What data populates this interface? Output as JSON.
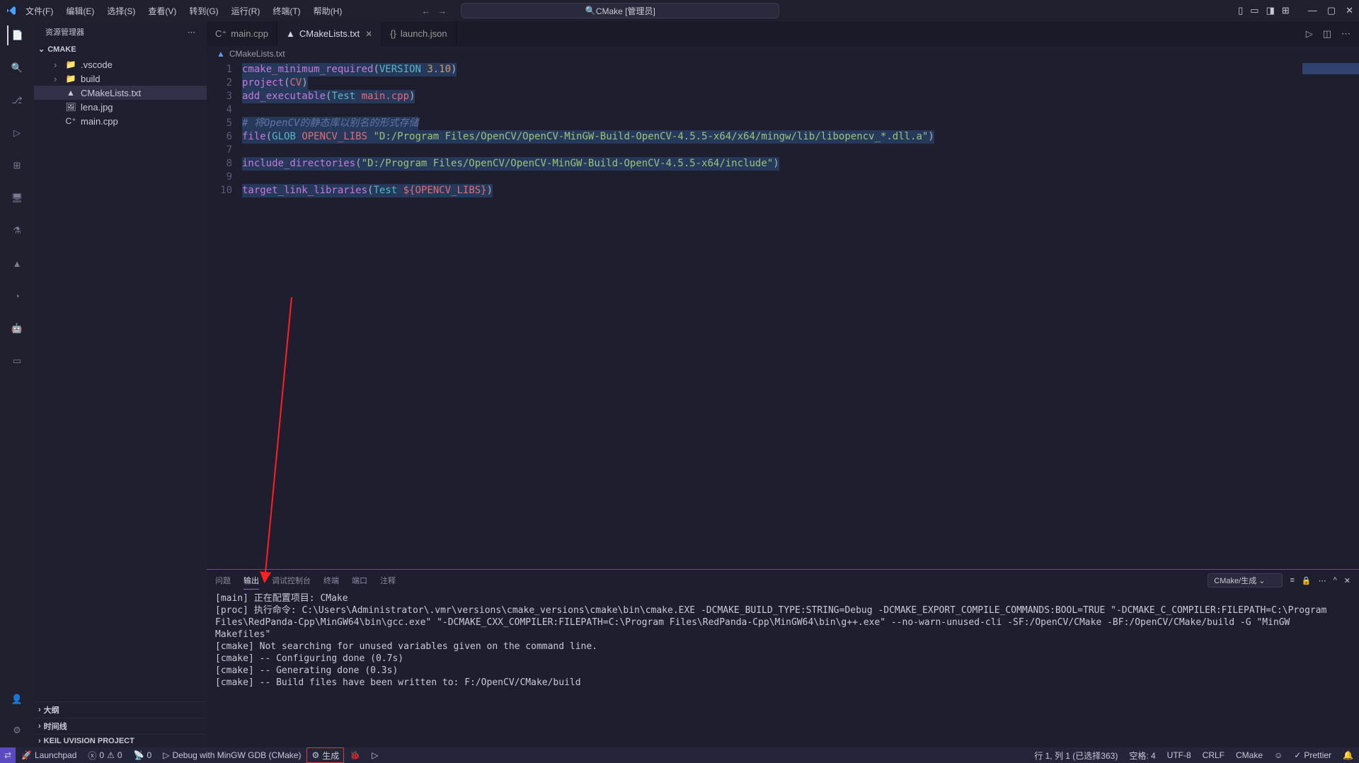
{
  "titlebar": {
    "menus": [
      "文件(F)",
      "编辑(E)",
      "选择(S)",
      "查看(V)",
      "转到(G)",
      "运行(R)",
      "终端(T)",
      "帮助(H)"
    ],
    "search_label": "CMake [管理员]"
  },
  "activitybar": {
    "items": [
      "explorer-icon",
      "search-icon",
      "scm-icon",
      "debug-icon",
      "extensions-icon",
      "remote-icon",
      "testing-icon",
      "cmake-icon",
      "timer-icon",
      "robot-icon",
      "layout-icon"
    ],
    "bottom_items": [
      "account-icon",
      "settings-icon"
    ]
  },
  "sidebar": {
    "title": "资源管理器",
    "project": "CMAKE",
    "tree": [
      {
        "label": ".vscode",
        "icon": "folder",
        "expandable": true
      },
      {
        "label": "build",
        "icon": "folder",
        "expandable": true
      },
      {
        "label": "CMakeLists.txt",
        "icon": "cmake",
        "selected": true
      },
      {
        "label": "lena.jpg",
        "icon": "image"
      },
      {
        "label": "main.cpp",
        "icon": "cpp"
      }
    ],
    "bottom_sections": [
      "大纲",
      "时间线",
      "KEIL UVISION PROJECT"
    ]
  },
  "tabs": [
    {
      "label": "main.cpp",
      "icon": "cpp",
      "active": false
    },
    {
      "label": "CMakeLists.txt",
      "icon": "cmake",
      "active": true
    },
    {
      "label": "launch.json",
      "icon": "json",
      "active": false
    }
  ],
  "breadcrumb": {
    "file": "CMakeLists.txt"
  },
  "editor": {
    "lines": [
      {
        "n": 1,
        "tokens": [
          [
            "tok-fn",
            "cmake_minimum_required"
          ],
          [
            "tok-punct",
            "("
          ],
          [
            "tok-kw",
            "VERSION"
          ],
          [
            "tok-punct",
            " "
          ],
          [
            "tok-num",
            "3.10"
          ],
          [
            "tok-punct",
            ")"
          ]
        ],
        "sel": true
      },
      {
        "n": 2,
        "tokens": [
          [
            "tok-fn",
            "project"
          ],
          [
            "tok-punct",
            "("
          ],
          [
            "tok-var",
            "CV"
          ],
          [
            "tok-punct",
            ")"
          ]
        ],
        "sel": true
      },
      {
        "n": 3,
        "tokens": [
          [
            "tok-fn",
            "add_executable"
          ],
          [
            "tok-punct",
            "("
          ],
          [
            "tok-kw",
            "Test"
          ],
          [
            "tok-punct",
            " "
          ],
          [
            "tok-var",
            "main.cpp"
          ],
          [
            "tok-punct",
            ")"
          ]
        ],
        "sel": true
      },
      {
        "n": 4,
        "tokens": [],
        "sel": true
      },
      {
        "n": 5,
        "tokens": [
          [
            "tok-cmt",
            "# 将OpenCV的静态库以别名的形式存储"
          ]
        ],
        "sel": true
      },
      {
        "n": 6,
        "tokens": [
          [
            "tok-fn",
            "file"
          ],
          [
            "tok-punct",
            "("
          ],
          [
            "tok-kw",
            "GLOB"
          ],
          [
            "tok-punct",
            " "
          ],
          [
            "tok-var",
            "OPENCV_LIBS"
          ],
          [
            "tok-punct",
            " "
          ],
          [
            "tok-str",
            "\"D:/Program Files/OpenCV/OpenCV-MinGW-Build-OpenCV-4.5.5-x64/x64/mingw/lib/libopencv_*.dll.a\""
          ],
          [
            "tok-punct",
            ")"
          ]
        ],
        "sel": true
      },
      {
        "n": 7,
        "tokens": [],
        "sel": true
      },
      {
        "n": 8,
        "tokens": [
          [
            "tok-fn",
            "include_directories"
          ],
          [
            "tok-punct",
            "("
          ],
          [
            "tok-str",
            "\"D:/Program Files/OpenCV/OpenCV-MinGW-Build-OpenCV-4.5.5-x64/include\""
          ],
          [
            "tok-punct",
            ")"
          ]
        ],
        "sel": true
      },
      {
        "n": 9,
        "tokens": [],
        "sel": true
      },
      {
        "n": 10,
        "tokens": [
          [
            "tok-fn",
            "target_link_libraries"
          ],
          [
            "tok-punct",
            "("
          ],
          [
            "tok-kw",
            "Test"
          ],
          [
            "tok-punct",
            " "
          ],
          [
            "tok-var",
            "${OPENCV_LIBS}"
          ],
          [
            "tok-punct",
            ")"
          ]
        ],
        "sel": true
      }
    ]
  },
  "panel": {
    "tabs": [
      "问题",
      "输出",
      "调试控制台",
      "终端",
      "端口",
      "注释"
    ],
    "active_tab_index": 1,
    "output_selector": "CMake/生成",
    "output": "[main] 正在配置项目: CMake \n[proc] 执行命令: C:\\Users\\Administrator\\.vmr\\versions\\cmake_versions\\cmake\\bin\\cmake.EXE -DCMAKE_BUILD_TYPE:STRING=Debug -DCMAKE_EXPORT_COMPILE_COMMANDS:BOOL=TRUE \"-DCMAKE_C_COMPILER:FILEPATH=C:\\Program Files\\RedPanda-Cpp\\MinGW64\\bin\\gcc.exe\" \"-DCMAKE_CXX_COMPILER:FILEPATH=C:\\Program Files\\RedPanda-Cpp\\MinGW64\\bin\\g++.exe\" --no-warn-unused-cli -SF:/OpenCV/CMake -BF:/OpenCV/CMake/build -G \"MinGW Makefiles\"\n[cmake] Not searching for unused variables given on the command line.\n[cmake] -- Configuring done (0.7s)\n[cmake] -- Generating done (0.3s)\n[cmake] -- Build files have been written to: F:/OpenCV/CMake/build\n"
  },
  "statusbar": {
    "left": {
      "launchpad": "Launchpad",
      "errors": "0",
      "warnings": "0",
      "ports": "0",
      "kit": "Debug with MinGW GDB (CMake)",
      "build": "生成"
    },
    "right": {
      "cursor": "行 1, 列 1 (已选择363)",
      "spaces": "空格: 4",
      "encoding": "UTF-8",
      "eol": "CRLF",
      "lang": "CMake",
      "prettier": "Prettier"
    }
  }
}
